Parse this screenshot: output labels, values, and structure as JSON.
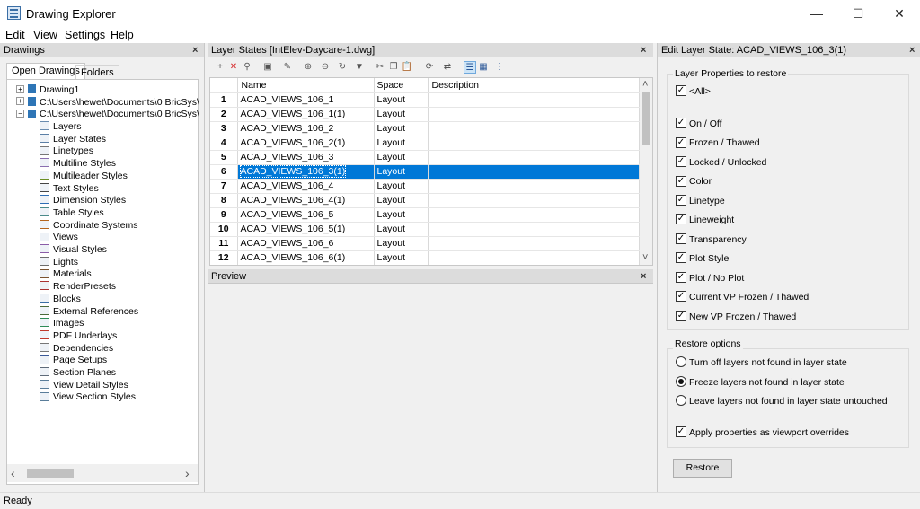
{
  "window": {
    "title": "Drawing Explorer",
    "minimize_glyph": "—",
    "maximize_glyph": "☐",
    "close_glyph": "✕"
  },
  "menu": [
    "Edit",
    "View",
    "Settings",
    "Help"
  ],
  "drawings_panel": {
    "title": "Drawings",
    "close": "×",
    "tabs": [
      "Open Drawings",
      "Folders"
    ],
    "roots": [
      {
        "label": "Drawing1",
        "expander": "+"
      },
      {
        "label": "C:\\Users\\hewet\\Documents\\0 BricSys\\",
        "expander": "+"
      },
      {
        "label": "C:\\Users\\hewet\\Documents\\0 BricSys\\",
        "expander": "−"
      }
    ],
    "children": [
      {
        "label": "Layers",
        "icon": "layers-icon"
      },
      {
        "label": "Layer States",
        "icon": "layer-states-icon"
      },
      {
        "label": "Linetypes",
        "icon": "linetypes-icon"
      },
      {
        "label": "Multiline Styles",
        "icon": "multiline-styles-icon"
      },
      {
        "label": "Multileader Styles",
        "icon": "multileader-styles-icon"
      },
      {
        "label": "Text Styles",
        "icon": "text-styles-icon"
      },
      {
        "label": "Dimension Styles",
        "icon": "dimension-styles-icon"
      },
      {
        "label": "Table Styles",
        "icon": "table-styles-icon"
      },
      {
        "label": "Coordinate Systems",
        "icon": "coordinate-systems-icon"
      },
      {
        "label": "Views",
        "icon": "views-icon"
      },
      {
        "label": "Visual Styles",
        "icon": "visual-styles-icon"
      },
      {
        "label": "Lights",
        "icon": "lights-icon"
      },
      {
        "label": "Materials",
        "icon": "materials-icon"
      },
      {
        "label": "RenderPresets",
        "icon": "render-presets-icon"
      },
      {
        "label": "Blocks",
        "icon": "blocks-icon"
      },
      {
        "label": "External References",
        "icon": "external-references-icon"
      },
      {
        "label": "Images",
        "icon": "images-icon"
      },
      {
        "label": "PDF Underlays",
        "icon": "pdf-underlays-icon"
      },
      {
        "label": "Dependencies",
        "icon": "dependencies-icon"
      },
      {
        "label": "Page Setups",
        "icon": "page-setups-icon"
      },
      {
        "label": "Section Planes",
        "icon": "section-planes-icon"
      },
      {
        "label": "View Detail Styles",
        "icon": "view-detail-styles-icon"
      },
      {
        "label": "View Section Styles",
        "icon": "view-section-styles-icon"
      }
    ],
    "scroll_left": "‹",
    "scroll_right": "›"
  },
  "layer_states_panel": {
    "title": "Layer States [IntElev-Daycare-1.dwg]",
    "close": "×",
    "toolbar_icons": [
      "new-icon",
      "delete-icon",
      "purge-icon",
      "import-icon",
      "export-icon",
      "add-layer-icon",
      "remove-layer-icon",
      "restore-icon",
      "save-icon",
      "cut-icon",
      "copy-icon",
      "paste-icon",
      "refresh-icon",
      "swap-icon",
      "details-view-icon",
      "grid-view-icon",
      "tree-view-icon"
    ],
    "toolbar_glyphs": [
      "+",
      "✕",
      "⚲",
      "▣",
      "✎",
      "⊕",
      "⊖",
      "↻",
      "▼",
      "✂",
      "❐",
      "📋",
      "⟳",
      "⇄",
      "☰",
      "▦",
      "⋮"
    ],
    "columns": [
      "Name",
      "Space",
      "Description"
    ],
    "rows": [
      {
        "n": "1",
        "name": "ACAD_VIEWS_106_1",
        "space": "Layout",
        "desc": ""
      },
      {
        "n": "2",
        "name": "ACAD_VIEWS_106_1(1)",
        "space": "Layout",
        "desc": ""
      },
      {
        "n": "3",
        "name": "ACAD_VIEWS_106_2",
        "space": "Layout",
        "desc": ""
      },
      {
        "n": "4",
        "name": "ACAD_VIEWS_106_2(1)",
        "space": "Layout",
        "desc": ""
      },
      {
        "n": "5",
        "name": "ACAD_VIEWS_106_3",
        "space": "Layout",
        "desc": ""
      },
      {
        "n": "6",
        "name": "ACAD_VIEWS_106_3(1)",
        "space": "Layout",
        "desc": ""
      },
      {
        "n": "7",
        "name": "ACAD_VIEWS_106_4",
        "space": "Layout",
        "desc": ""
      },
      {
        "n": "8",
        "name": "ACAD_VIEWS_106_4(1)",
        "space": "Layout",
        "desc": ""
      },
      {
        "n": "9",
        "name": "ACAD_VIEWS_106_5",
        "space": "Layout",
        "desc": ""
      },
      {
        "n": "10",
        "name": "ACAD_VIEWS_106_5(1)",
        "space": "Layout",
        "desc": ""
      },
      {
        "n": "11",
        "name": "ACAD_VIEWS_106_6",
        "space": "Layout",
        "desc": ""
      },
      {
        "n": "12",
        "name": "ACAD_VIEWS_106_6(1)",
        "space": "Layout",
        "desc": ""
      }
    ],
    "selected_row": "6",
    "scroll_up": "˄",
    "scroll_down": "˅"
  },
  "preview_panel": {
    "title": "Preview",
    "close": "×"
  },
  "edit_panel": {
    "title": "Edit Layer State: ACAD_VIEWS_106_3(1)",
    "close": "×",
    "properties_label": "Layer Properties to restore",
    "all_label": "<All>",
    "properties": [
      "On / Off",
      "Frozen / Thawed",
      "Locked / Unlocked",
      "Color",
      "Linetype",
      "Lineweight",
      "Transparency",
      "Plot Style",
      "Plot / No Plot",
      "Current VP Frozen / Thawed",
      "New VP Frozen / Thawed"
    ],
    "check_glyph": "✓",
    "restore_options_label": "Restore options",
    "restore_options": [
      {
        "label": "Turn off layers not found in layer state",
        "selected": false
      },
      {
        "label": "Freeze layers not found in layer state",
        "selected": true
      },
      {
        "label": "Leave layers not found in layer state untouched",
        "selected": false
      }
    ],
    "viewport_overrides_label": "Apply properties as viewport overrides",
    "restore_button": "Restore"
  },
  "status_bar": {
    "text": "Ready"
  },
  "colors": {
    "selection": "#0078d7",
    "panel_header": "#dcdcdc",
    "window_bg": "#f0f0f0"
  }
}
